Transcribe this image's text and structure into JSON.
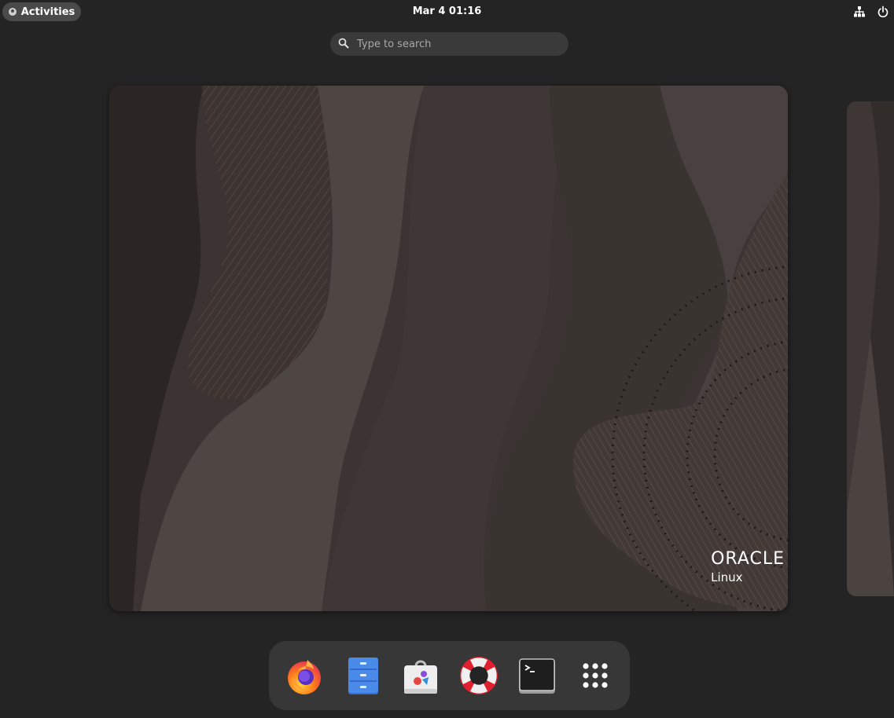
{
  "topbar": {
    "activities_label": "Activities",
    "clock": "Mar 4  01:16",
    "icons": [
      "network-icon",
      "power-icon"
    ]
  },
  "search": {
    "placeholder": "Type to search",
    "icon": "search-icon"
  },
  "workspace": {
    "brand_primary": "ORACLE",
    "brand_secondary": "Linux"
  },
  "dash": {
    "apps": [
      {
        "name": "Firefox",
        "icon": "firefox-icon"
      },
      {
        "name": "Files",
        "icon": "files-icon"
      },
      {
        "name": "Software",
        "icon": "software-icon"
      },
      {
        "name": "Help",
        "icon": "help-icon"
      },
      {
        "name": "Terminal",
        "icon": "terminal-icon"
      },
      {
        "name": "Show Apps",
        "icon": "app-grid-icon"
      }
    ]
  },
  "colors": {
    "background": "#242424",
    "panel_pill": "#4a4a4a",
    "dash": "#373737",
    "wallpaper": "#3c3533"
  }
}
